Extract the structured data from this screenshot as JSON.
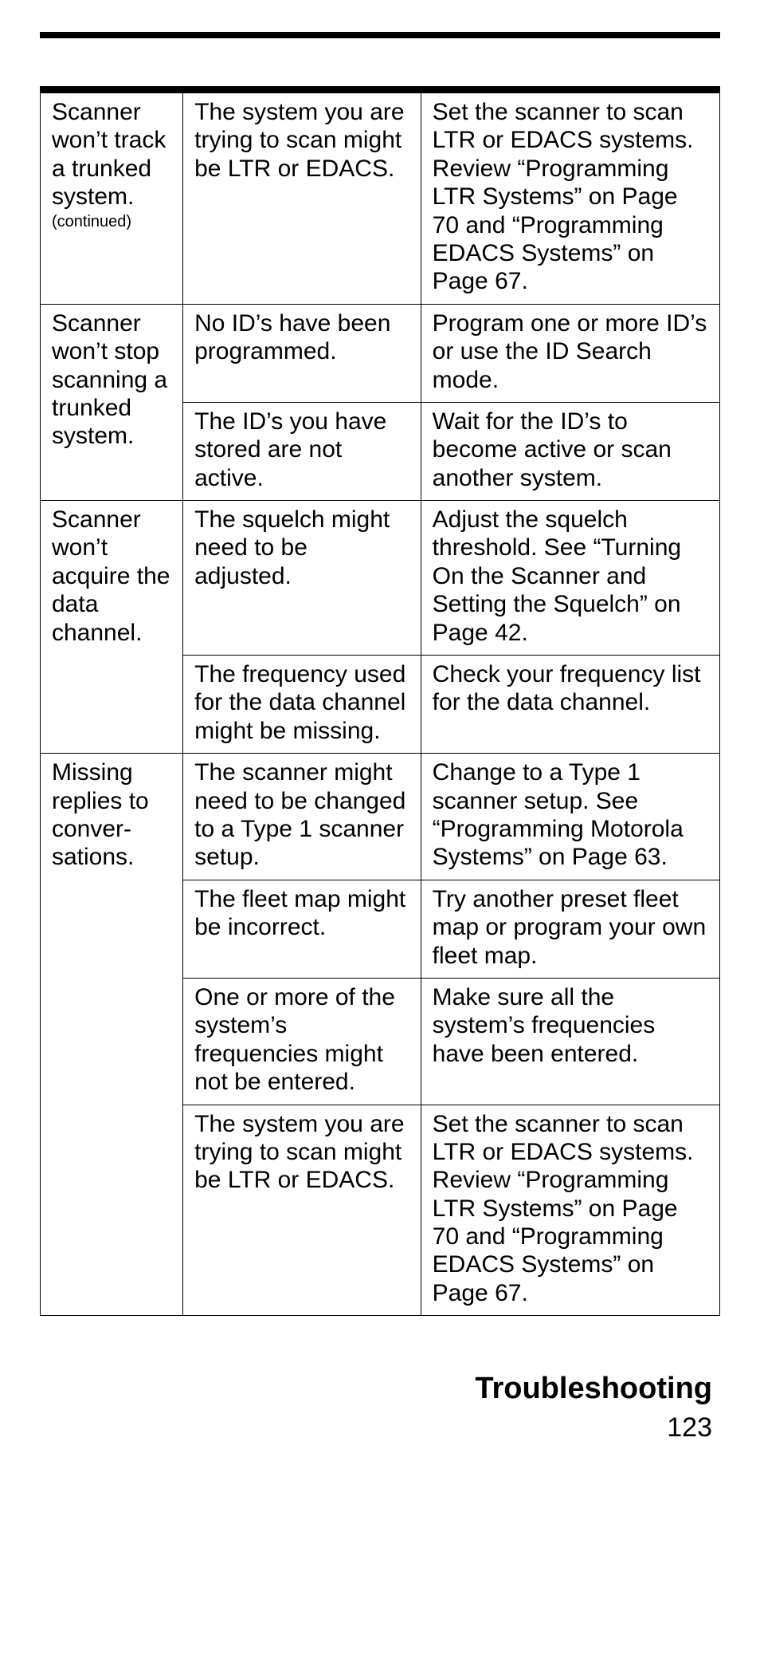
{
  "rows": [
    {
      "problem": "Scanner won’t track a trunked system.",
      "continued": "(continued)",
      "cause": "The system you are trying to scan might be LTR or EDACS.",
      "solution": "Set the scanner to scan LTR or EDACS systems. Review “Programming LTR Systems” on Page 70 and “Programming EDACS Systems” on Page 67."
    },
    {
      "problem": "Scanner won’t stop scanning a trunked system.",
      "cause": "No ID’s have been programmed.",
      "solution": "Program one or more ID’s or use the ID Search mode."
    },
    {
      "cause": "The ID’s you have stored are not active.",
      "solution": "Wait for the ID’s to become active or scan another system."
    },
    {
      "problem": "Scanner won’t acquire the data channel.",
      "cause": "The squelch might need to be adjusted.",
      "solution": "Adjust the squelch threshold. See “Turning On the Scanner and Setting the Squelch” on Page 42."
    },
    {
      "cause": "The frequency used for the data channel might be missing.",
      "solution": "Check your frequency list for the data channel."
    },
    {
      "problem": "Missing replies to conver-sations.",
      "cause": "The scanner might need to be changed to a Type 1 scanner setup.",
      "solution": "Change to a Type 1 scanner setup. See “Programming Motorola Systems” on Page 63."
    },
    {
      "cause": "The fleet map might be incorrect.",
      "solution": "Try another preset fleet map or program your own fleet map."
    },
    {
      "cause": "One or more of the system’s frequencies might not be entered.",
      "solution": "Make sure all the system’s frequencies have been entered."
    },
    {
      "cause": "The system you are trying to scan might be LTR or EDACS.",
      "solution": "Set the scanner to scan LTR or EDACS systems. Review “Programming LTR Systems” on Page 70 and “Programming EDACS Systems” on Page 67."
    }
  ],
  "section_title": "Troubleshooting",
  "page_number": "123"
}
